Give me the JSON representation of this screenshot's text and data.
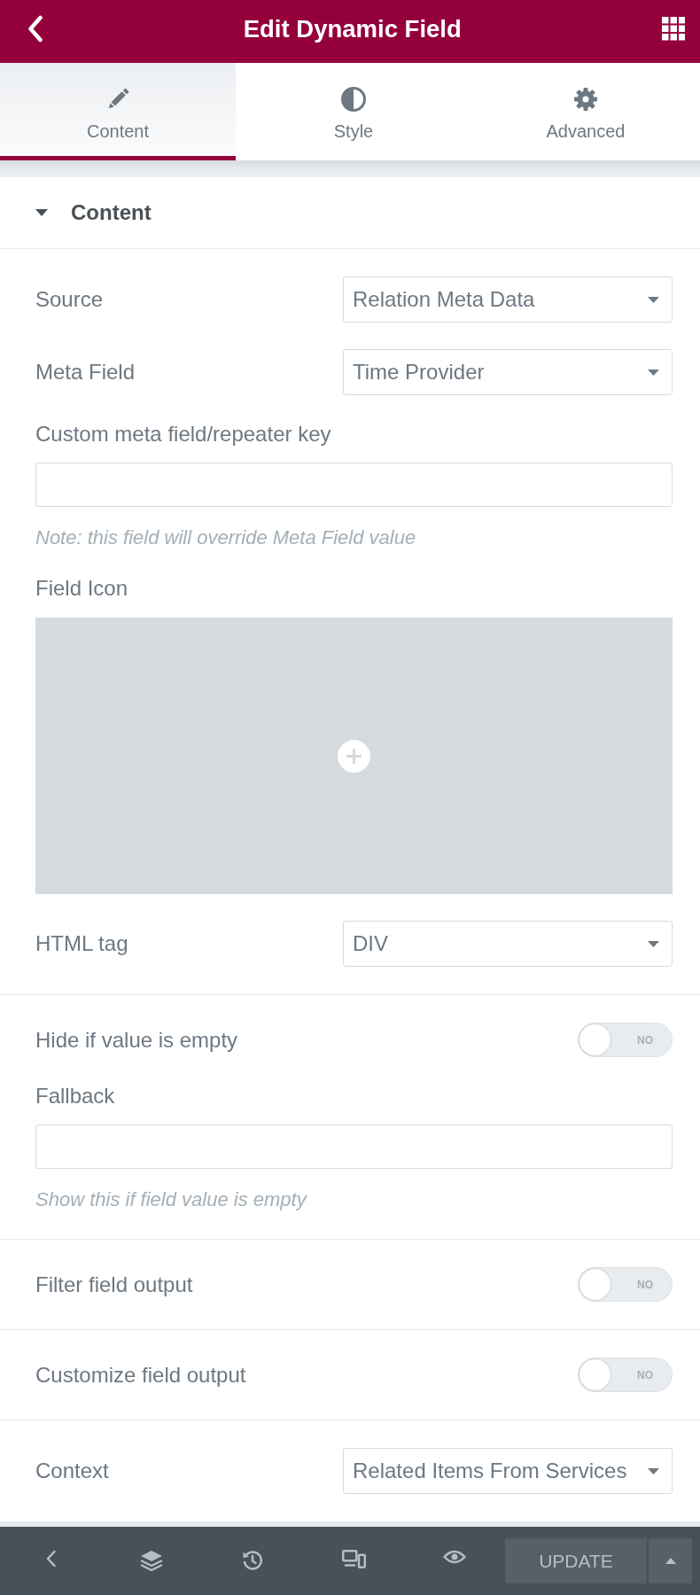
{
  "header": {
    "title": "Edit Dynamic Field"
  },
  "tabs": [
    {
      "label": "Content",
      "selected": true
    },
    {
      "label": "Style",
      "selected": false
    },
    {
      "label": "Advanced",
      "selected": false
    }
  ],
  "section": {
    "title": "Content",
    "expanded": true,
    "groups": [
      {
        "controls": [
          {
            "kind": "select",
            "label": "Source",
            "value": "Relation Meta Data"
          },
          {
            "kind": "select",
            "label": "Meta Field",
            "value": "Time Provider"
          },
          {
            "kind": "text",
            "label": "Custom meta field/repeater key",
            "note": "Note: this field will override Meta Field value"
          },
          {
            "kind": "icon",
            "label": "Field Icon"
          },
          {
            "kind": "select",
            "label": "HTML tag",
            "value": "DIV"
          }
        ]
      },
      {
        "controls": [
          {
            "kind": "switch",
            "label": "Hide if value is empty",
            "on": false,
            "state_text": "NO"
          },
          {
            "kind": "text",
            "label": "Fallback",
            "note": "Show this if field value is empty"
          }
        ]
      },
      {
        "controls": [
          {
            "kind": "switch",
            "label": "Filter field output",
            "on": false,
            "state_text": "NO"
          }
        ]
      },
      {
        "controls": [
          {
            "kind": "switch",
            "label": "Customize field output",
            "on": false,
            "state_text": "NO"
          }
        ]
      },
      {
        "controls": [
          {
            "kind": "select",
            "label": "Context",
            "value": "Related Items From Services"
          }
        ]
      }
    ]
  },
  "footer": {
    "update": {
      "label": "UPDATE",
      "disabled": true
    }
  }
}
